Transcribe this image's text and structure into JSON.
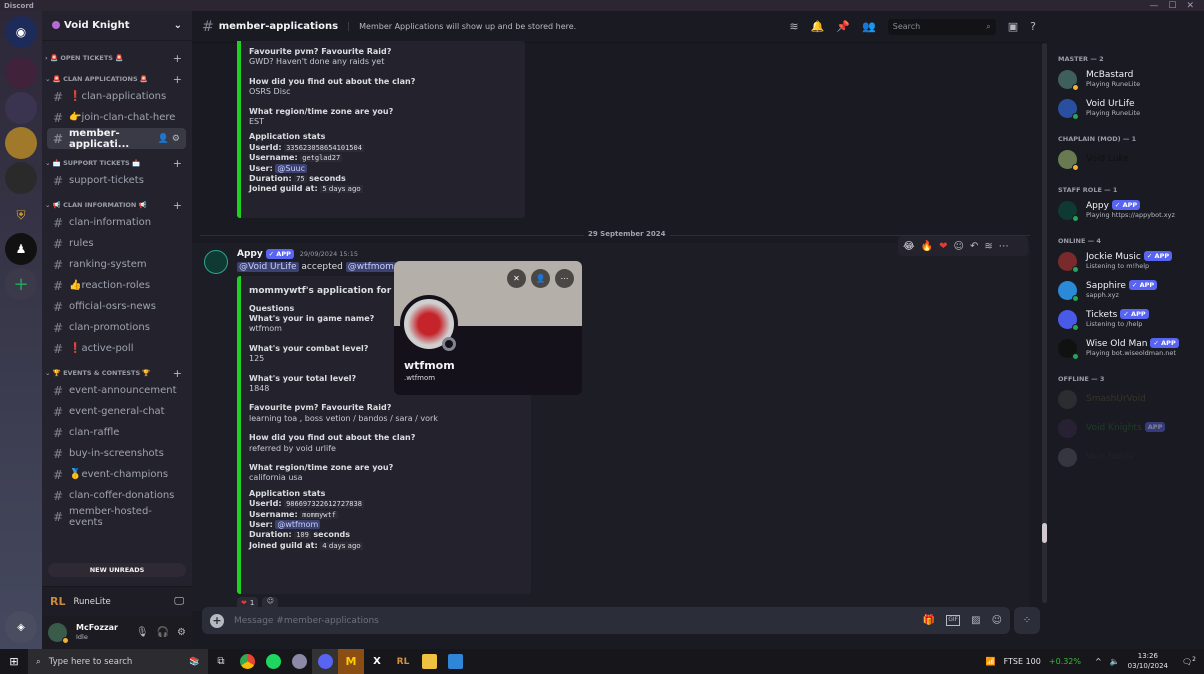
{
  "window": {
    "app_name": "Discord",
    "minimize": "—",
    "maximize": "☐",
    "close": "✕"
  },
  "guild": {
    "name": "Void Knight",
    "chevron": "⌄"
  },
  "categories": [
    {
      "name": "OPEN TICKETS",
      "emoji": "🚨",
      "collapsed": true
    },
    {
      "name": "CLAN APPLICATIONS",
      "emoji": "🚨",
      "collapsed": false,
      "channels": [
        "❗clan-applications",
        "👉join-clan-chat-here",
        "member-applicati..."
      ]
    },
    {
      "name": "SUPPORT TICKETS",
      "emoji": "📩",
      "collapsed": false,
      "channels": [
        "support-tickets"
      ]
    },
    {
      "name": "CLAN INFORMATION",
      "emoji": "📢",
      "collapsed": false,
      "channels": [
        "clan-information",
        "rules",
        "ranking-system",
        "👍reaction-roles",
        "official-osrs-news",
        "clan-promotions",
        "❗active-poll"
      ]
    },
    {
      "name": "EVENTS & CONTESTS",
      "emoji": "🏆",
      "collapsed": false,
      "channels": [
        "event-announcement",
        "event-general-chat",
        "clan-raffle",
        "buy-in-screenshots",
        "🥇event-champions",
        "clan-coffer-donations",
        "member-hosted-events"
      ]
    }
  ],
  "new_unreads": "NEW UNREADS",
  "activity": {
    "name": "RuneLite"
  },
  "user": {
    "name": "McFozzar",
    "status": "Idle"
  },
  "channel": {
    "name": "member-applications",
    "topic": "Member Applications will show up and be stored here."
  },
  "search": {
    "placeholder": "Search"
  },
  "prev_embed": {
    "q1": "Favourite pvm? Favourite Raid?",
    "a1": "GWD? Haven't done any raids yet",
    "q2": "How did you find out about the clan?",
    "a2": "OSRS Disc",
    "q3": "What region/time zone are you?",
    "a3": "EST",
    "stats_title": "Application stats",
    "userid_label": "UserId:",
    "userid": "335623058654101504",
    "username_label": "Username:",
    "username": "getglad27",
    "user_label": "User:",
    "user": "@Suuc",
    "duration_label": "Duration:",
    "duration": "75",
    "duration_unit": "seconds",
    "joined_label": "Joined guild at:",
    "joined": "5 days ago"
  },
  "date_divider": "29 September 2024",
  "message": {
    "author": "Appy",
    "badge": "✓ APP",
    "timestamp": "29/09/2024 15:15",
    "mention1": "@Void UrLife",
    "text": "accepted",
    "mention2": "@wtfmom",
    "suffix": "'s",
    "embed": {
      "title": "mommywtf's application for Mem",
      "questions_title": "Questions",
      "q1": "What's your in game name?",
      "a1": "wtfmom",
      "q2": "What's your combat level?",
      "a2": "125",
      "q3": "What's your total level?",
      "a3": "1848",
      "q4": "Favourite pvm? Favourite Raid?",
      "a4": "learning toa , boss vetion / bandos / sara / vork",
      "q5": "How did you find out about the clan?",
      "a5": "referred by void urlife",
      "q6": "What region/time zone are you?",
      "a6": "california usa",
      "stats_title": "Application stats",
      "userid_label": "UserId:",
      "userid": "986697322612727838",
      "username_label": "Username:",
      "username": "mommywtf",
      "user_label": "User:",
      "user": "@wtfmom",
      "duration_label": "Duration:",
      "duration": "109",
      "duration_unit": "seconds",
      "joined_label": "Joined guild at:",
      "joined": "4 days ago"
    },
    "reaction_count": "1"
  },
  "profile_popup": {
    "display_name": "wtfmom",
    "username": ".wtfmom"
  },
  "composer": {
    "placeholder": "Message #member-applications"
  },
  "members": {
    "groups": [
      {
        "label": "MASTER — 2",
        "items": [
          {
            "name": "McBastard",
            "sub": "Playing RuneLite",
            "color": "#f2f3f5",
            "status": "idle"
          },
          {
            "name": "Void UrLife",
            "sub": "Playing RuneLite",
            "color": "#f2f3f5",
            "status": "online"
          }
        ]
      },
      {
        "label": "CHAPLAIN (MOD) — 1",
        "items": [
          {
            "name": "Void Luke",
            "sub": "",
            "color": "#111111",
            "status": "idle"
          }
        ]
      },
      {
        "label": "STAFF ROLE — 1",
        "items": [
          {
            "name": "Appy",
            "sub": "Playing https://appybot.xyz",
            "color": "#f2f3f5",
            "status": "online",
            "badge": "✓ APP"
          }
        ]
      },
      {
        "label": "ONLINE — 4",
        "items": [
          {
            "name": "Jockie Music",
            "sub": "Listening to m!help",
            "color": "#f2f3f5",
            "status": "online",
            "badge": "✓ APP"
          },
          {
            "name": "Sapphire",
            "sub": "sapph.xyz",
            "color": "#f2f3f5",
            "status": "online",
            "badge": "✓ APP"
          },
          {
            "name": "Tickets",
            "sub": "Listening to /help",
            "color": "#f2f3f5",
            "status": "online",
            "badge": "✓ APP"
          },
          {
            "name": "Wise Old Man",
            "sub": "Playing bot.wiseoldman.net",
            "color": "#f2f3f5",
            "status": "online",
            "badge": "✓ APP"
          }
        ]
      },
      {
        "label": "OFFLINE — 3",
        "items": [
          {
            "name": "SmashUrVoid",
            "sub": "",
            "color": "#5c5030"
          },
          {
            "name": "Void Knights",
            "sub": "",
            "color": "#1d6b26",
            "badge": "APP"
          },
          {
            "name": "Void Noble",
            "sub": "",
            "color": "#2a2a30"
          }
        ]
      }
    ]
  },
  "taskbar": {
    "search_placeholder": "Type here to search",
    "ticker": "FTSE 100",
    "ticker_change": "+0.32%",
    "time": "13:26",
    "date": "03/10/2024",
    "notifications": "2"
  }
}
